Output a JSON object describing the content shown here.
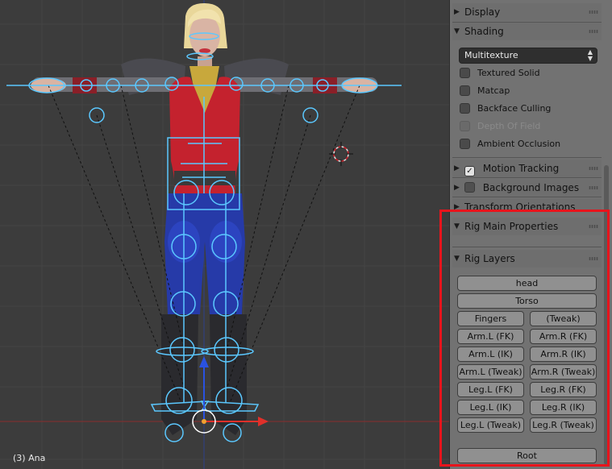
{
  "viewport": {
    "status_text": "(3) Ana"
  },
  "panel": {
    "sections_top": [
      {
        "label": "Display",
        "expanded": false
      },
      {
        "label": "Shading",
        "expanded": true
      }
    ],
    "shading": {
      "mode": "Multitexture",
      "options": [
        {
          "label": "Textured Solid",
          "checked": false,
          "enabled": true
        },
        {
          "label": "Matcap",
          "checked": false,
          "enabled": true
        },
        {
          "label": "Backface Culling",
          "checked": false,
          "enabled": true
        },
        {
          "label": "Depth Of Field",
          "checked": false,
          "enabled": false
        },
        {
          "label": "Ambient Occlusion",
          "checked": false,
          "enabled": true
        }
      ]
    },
    "motion_tracking": {
      "label": "Motion Tracking",
      "checked": true
    },
    "background_images": {
      "label": "Background Images",
      "checked": false
    },
    "transform_orientations": {
      "label": "Transform Orientations"
    },
    "rig_main_properties": {
      "label": "Rig Main Properties"
    },
    "rig_layers": {
      "label": "Rig Layers",
      "head": "head",
      "torso": "Torso",
      "rows": [
        [
          "Fingers",
          "(Tweak)"
        ],
        [
          "Arm.L (FK)",
          "Arm.R (FK)"
        ],
        [
          "Arm.L (IK)",
          "Arm.R (IK)"
        ],
        [
          "Arm.L (Tweak)",
          "Arm.R (Tweak)"
        ],
        [
          "Leg.L (FK)",
          "Leg.R (FK)"
        ],
        [
          "Leg.L (IK)",
          "Leg.R (IK)"
        ],
        [
          "Leg.L (Tweak)",
          "Leg.R (Tweak)"
        ]
      ],
      "root": "Root"
    },
    "colors": {
      "highlight_frame": "#e8141c",
      "bone": "#5bc8ff",
      "axis_x": "#e0302a",
      "axis_z": "#2a52e0"
    }
  }
}
